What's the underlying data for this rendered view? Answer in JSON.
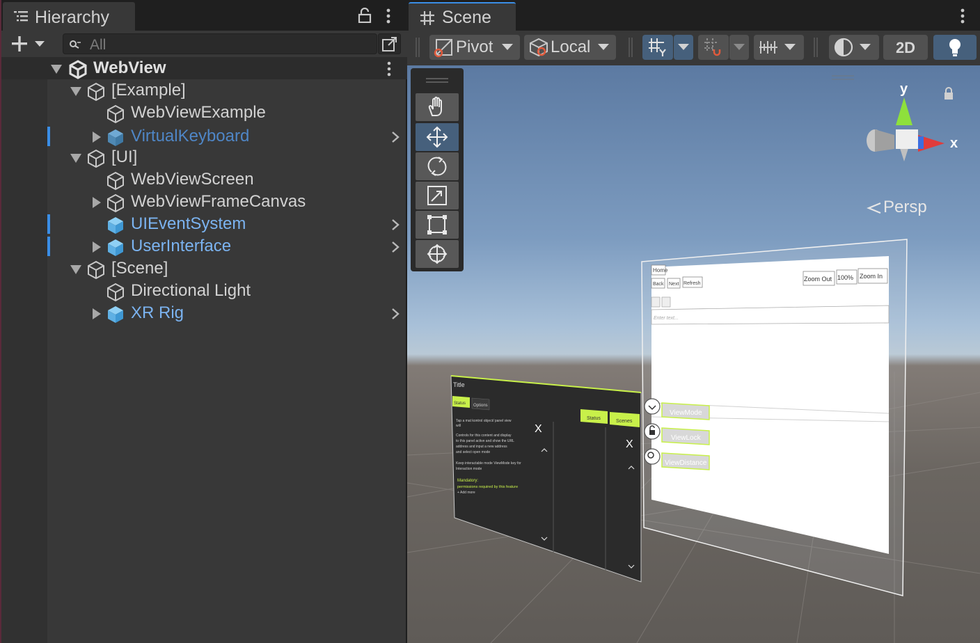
{
  "hierarchy": {
    "tab_title": "Hierarchy",
    "search_placeholder": "All",
    "tab_icon": "hierarchy-list-icon",
    "root": {
      "label": "WebView"
    },
    "rows": [
      {
        "label": "[Example]",
        "style": "group"
      },
      {
        "label": "WebViewExample",
        "style": "normal"
      },
      {
        "label": "VirtualKeyboard",
        "style": "prefab-disabled"
      },
      {
        "label": "[UI]",
        "style": "group"
      },
      {
        "label": "WebViewScreen",
        "style": "normal"
      },
      {
        "label": "WebViewFrameCanvas",
        "style": "normal"
      },
      {
        "label": "UIEventSystem",
        "style": "prefab"
      },
      {
        "label": "UserInterface",
        "style": "prefab"
      },
      {
        "label": "[Scene]",
        "style": "group"
      },
      {
        "label": "Directional Light",
        "style": "normal"
      },
      {
        "label": "XR Rig",
        "style": "prefab"
      }
    ]
  },
  "scene": {
    "tab_title": "Scene",
    "toolbar": {
      "pivot_label": "Pivot",
      "local_label": "Local",
      "twod_label": "2D"
    },
    "gizmo": {
      "y_label": "y",
      "x_label": "x",
      "projection_label": "Persp"
    },
    "webview_panel": {
      "home": "Home",
      "back": "Back",
      "next": "Next",
      "refresh": "Refresh",
      "zoom_out": "Zoom Out",
      "zoom_level": "100%",
      "zoom_in": "Zoom In",
      "url_placeholder": "Enter text...",
      "view_mode": "ViewMode",
      "view_lock": "ViewLock",
      "view_distance": "ViewDistance"
    },
    "dialog_panel": {
      "title": "Title",
      "tab1": "Status",
      "tab2": "Options",
      "status_button": "Status",
      "scenes_button": "Scenes",
      "line1": "Tap a mat kontrol object/ panel view",
      "line2": "will",
      "line3": "Controls for this content and display",
      "line4": "to this panel active and show the URL",
      "line5": "address and input a new address",
      "line6": "and select open mode",
      "line7": "Keep interactable mode ViewMode key for",
      "line8": "Interaction mode",
      "mandatory": "Mandatory:",
      "mandatory_detail": "permissions required by this feature",
      "mandatory_tail": "+ Add more"
    },
    "colors": {
      "accent_green": "#c8f04a",
      "prefab_blue": "#7bb3f0",
      "selection_blue": "#3a8ee6",
      "axis_red": "#e03c3c",
      "axis_green": "#8ee03c",
      "axis_blue": "#3c6ee0"
    }
  }
}
